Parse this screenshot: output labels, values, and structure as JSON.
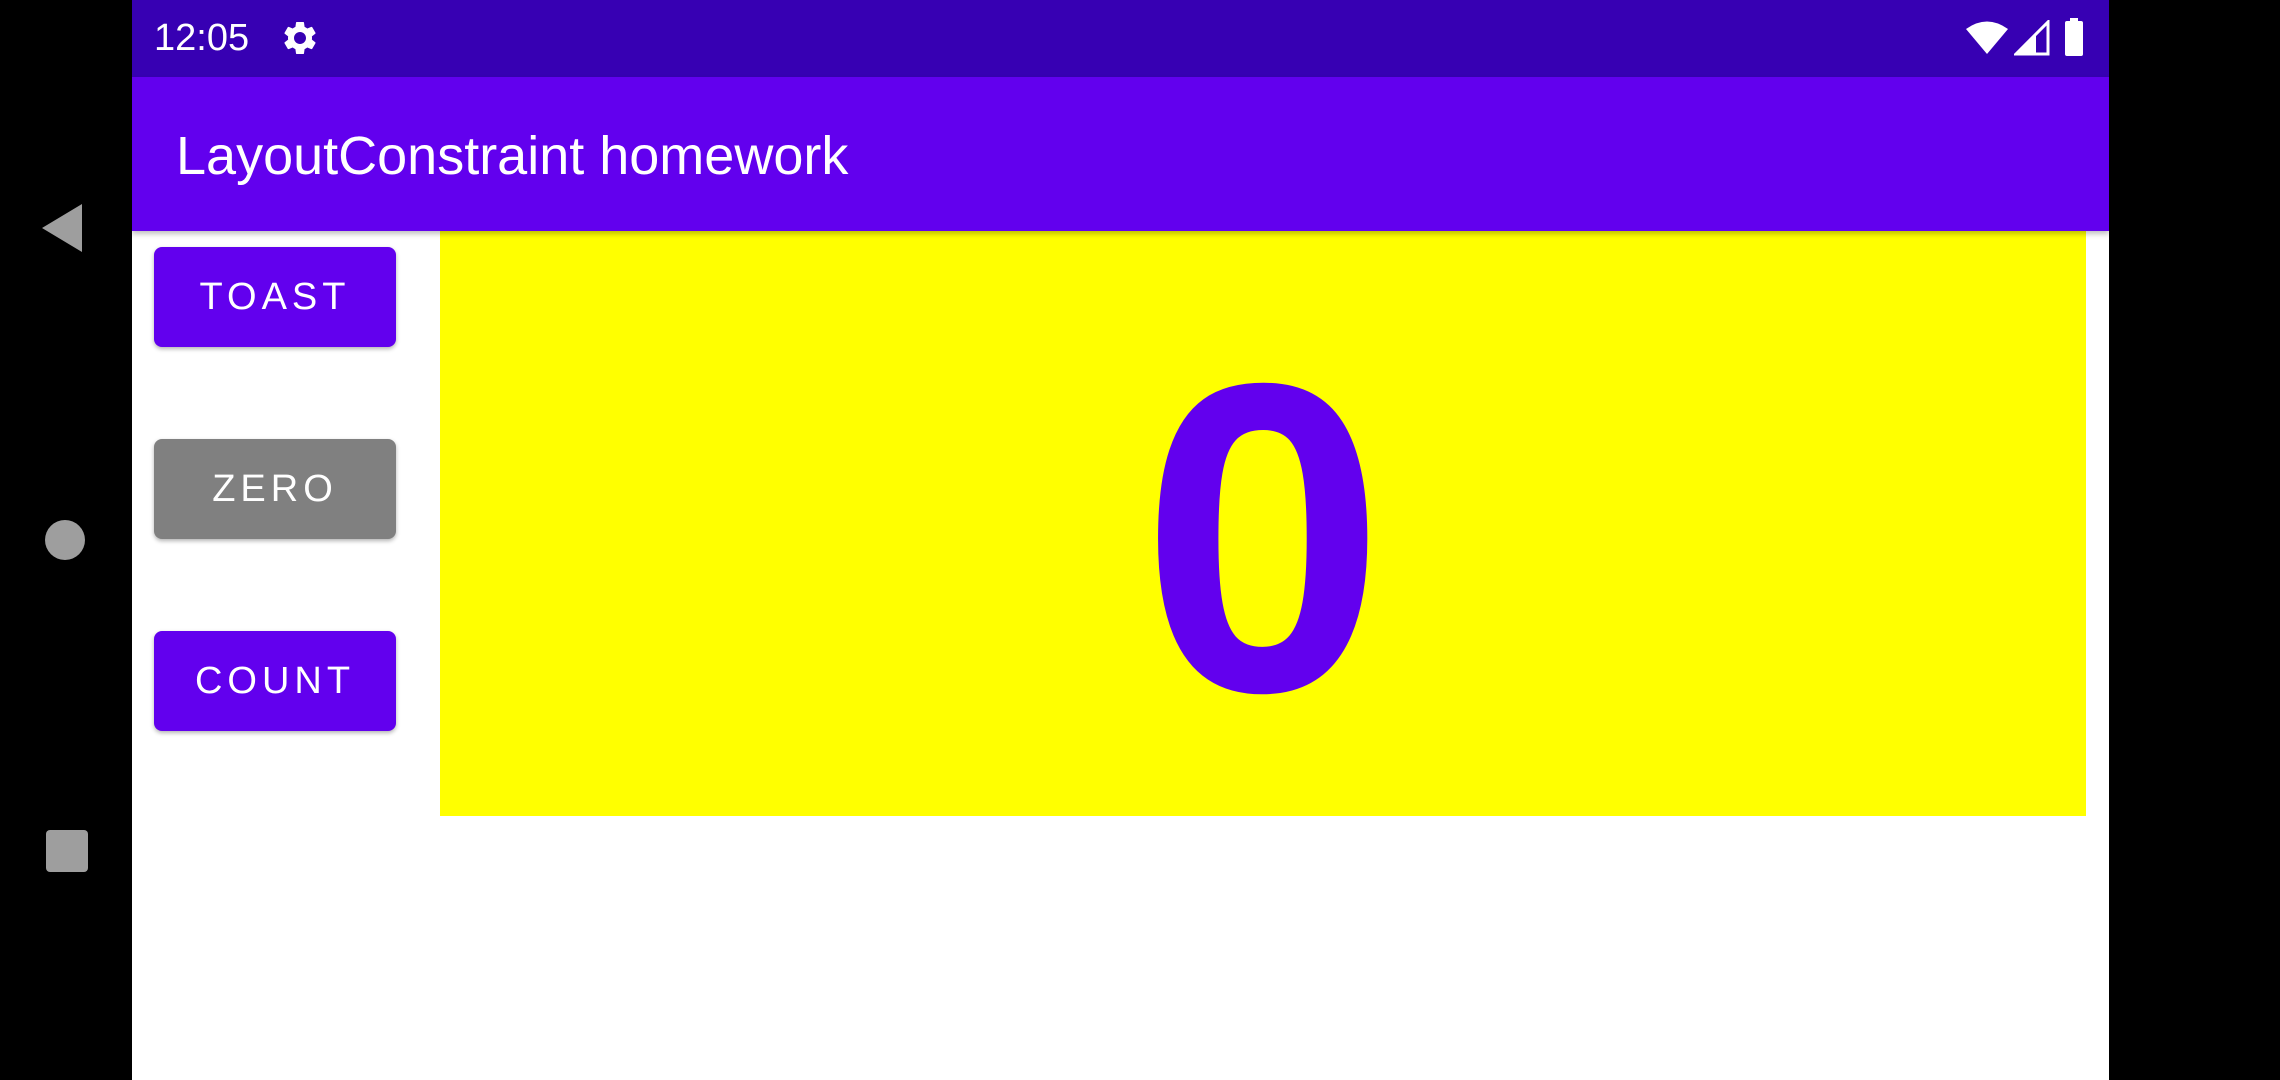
{
  "status_bar": {
    "time": "12:05",
    "icons": [
      "gear-icon",
      "wifi-icon",
      "signal-icon",
      "battery-icon"
    ],
    "background_color": "#3700b3"
  },
  "app_bar": {
    "title": "LayoutConstraint homework",
    "background_color": "#6200ee"
  },
  "buttons": {
    "toast_label": "TOAST",
    "zero_label": "ZERO",
    "count_label": "COUNT",
    "primary_color": "#6200ee",
    "zero_color": "#808080"
  },
  "counter": {
    "value": "0",
    "background_color": "#ffff00",
    "text_color": "#6200ee"
  },
  "navigation": {
    "icons": [
      "back-icon",
      "home-icon",
      "recents-icon"
    ]
  }
}
